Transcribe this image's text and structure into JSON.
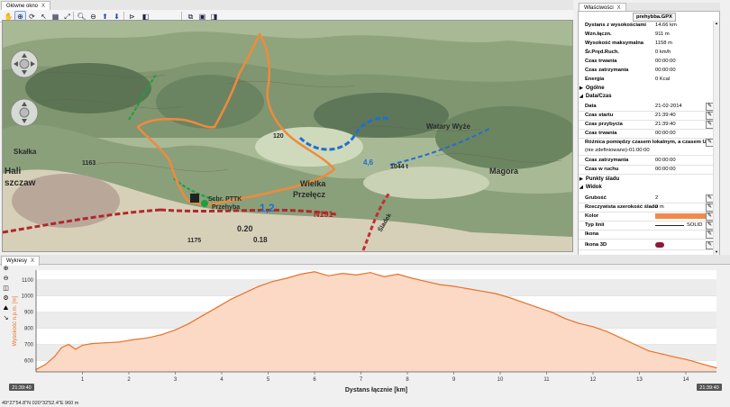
{
  "main_tab": {
    "label": "Główne okno",
    "close": "X"
  },
  "props_tab": {
    "label": "Właściwości",
    "close": "X"
  },
  "chart_tab": {
    "label": "Wykresy",
    "close": "X"
  },
  "toolbar": {
    "icons": [
      "pan-icon",
      "zoom-area-icon",
      "rotate-icon",
      "cursor-icon",
      "grid-icon",
      "zoom-in-icon",
      "zoom-out-icon",
      "arrow-up-icon",
      "arrow-down-icon",
      "route-icon",
      "layers-icon",
      "copy-icon",
      "paste-icon",
      "window-icon"
    ]
  },
  "map": {
    "labels": {
      "halicz": "Hali",
      "halicz2": "szczaw",
      "skalka": "Skałka",
      "wielka": "Wielka",
      "przeleczba": "Przełęcz",
      "schr": "Schr. PTTK",
      "przelyba": "Przehyba",
      "watary": "Watary Wyże",
      "magora": "Magora",
      "n191": "N191",
      "n12": "1,2",
      "n1163": "1163",
      "n1175": "1175",
      "n120": "120",
      "n1044": "1044 t",
      "n020": "0.20",
      "n018": "0.18",
      "n46": "4,6",
      "slade": "Śladek"
    }
  },
  "properties": {
    "track_name": "prehybba.GPX",
    "summary": [
      {
        "label": "Dystans z wysokościami",
        "value": "14.66 km"
      },
      {
        "label": "Wzn.łączn.",
        "value": "911 m"
      },
      {
        "label": "Wysokość maksymalna",
        "value": "1158 m"
      },
      {
        "label": "Śr.Pręd.Ruch.",
        "value": "0 km/h"
      },
      {
        "label": "Czas trwania",
        "value": "00:00:00"
      },
      {
        "label": "Czas zatrzymania",
        "value": "00:00:00"
      },
      {
        "label": "Energia",
        "value": "0 Kcal"
      }
    ],
    "sections": {
      "ogolne": "Ogólne",
      "datetime": "Data/Czas",
      "points": "Punkty śladu",
      "view": "Widok"
    },
    "datetime": [
      {
        "label": "Data",
        "value": "21-02-2014"
      },
      {
        "label": "Czas startu",
        "value": "21:39:40"
      },
      {
        "label": "Czas przybycia",
        "value": "21:39:40"
      },
      {
        "label": "Czas trwania",
        "value": "00:00:00"
      }
    ],
    "tz_label": "Różnica pomiędzy czasem lokalnym, a czasem UTC:",
    "tz_value": "(nie zdefiniowano)-01:00:00",
    "datetime2": [
      {
        "label": "Czas zatrzymania",
        "value": "00:00:00"
      },
      {
        "label": "Czas w ruchu",
        "value": "00:00:00"
      }
    ],
    "view": [
      {
        "label": "Grubość",
        "value": "2"
      },
      {
        "label": "Rzeczywista szerokość śladu",
        "value": "0 m"
      },
      {
        "label": "Kolor",
        "value": ""
      },
      {
        "label": "Typ linii",
        "value": "SOLID"
      },
      {
        "label": "Ikona",
        "value": ""
      },
      {
        "label": "Ikona 3D",
        "value": ""
      }
    ],
    "color_value": "#f08a4b",
    "icon3d_color": "#8b1a3a"
  },
  "chart_data": {
    "type": "area",
    "xlabel": "Dystans łącznie [km]",
    "ylabel": "Wysokość n.p.m. [m]",
    "xlim": [
      0,
      14.66
    ],
    "ylim": [
      530,
      1160
    ],
    "x_ticks": [
      1,
      2,
      3,
      4,
      5,
      6,
      7,
      8,
      9,
      10,
      11,
      12,
      13,
      14
    ],
    "y_ticks": [
      600,
      700,
      800,
      900,
      1000,
      1100
    ],
    "start_time": "21:39:40",
    "end_time": "21:39:40",
    "line_color": "#e8732a",
    "fill_color": "#fbd9c5",
    "x": [
      0,
      0.2,
      0.4,
      0.55,
      0.7,
      0.85,
      1.0,
      1.2,
      1.5,
      1.8,
      2.1,
      2.4,
      2.7,
      3.0,
      3.3,
      3.6,
      3.9,
      4.2,
      4.5,
      4.8,
      5.1,
      5.4,
      5.7,
      6.0,
      6.3,
      6.6,
      6.9,
      7.2,
      7.5,
      7.8,
      8.1,
      8.4,
      8.7,
      9.0,
      9.3,
      9.6,
      9.9,
      10.2,
      10.5,
      10.8,
      11.1,
      11.4,
      11.7,
      12.0,
      12.3,
      12.6,
      12.9,
      13.2,
      13.5,
      13.8,
      14.1,
      14.4,
      14.66
    ],
    "y": [
      545,
      575,
      625,
      680,
      700,
      670,
      695,
      705,
      710,
      715,
      730,
      740,
      760,
      790,
      830,
      880,
      930,
      980,
      1020,
      1060,
      1090,
      1110,
      1135,
      1150,
      1125,
      1140,
      1130,
      1145,
      1120,
      1135,
      1110,
      1090,
      1070,
      1060,
      1045,
      1030,
      1015,
      990,
      960,
      930,
      900,
      860,
      830,
      810,
      780,
      740,
      700,
      660,
      640,
      620,
      600,
      575,
      555
    ]
  },
  "status": {
    "coords": "49°27'54.8\"N 020°32'52.4\"E 960 m"
  }
}
